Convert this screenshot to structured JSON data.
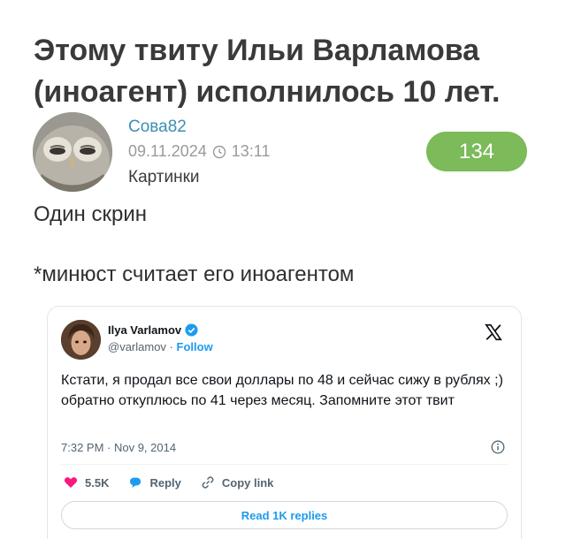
{
  "post": {
    "title": "Этому твиту Ильи Варламова (иноагент) исполнилось 10 лет.",
    "author": "Сова82",
    "date": "09.11.2024",
    "time": "13:11",
    "category": "Картинки",
    "rating": "134",
    "body_line_1": "Один скрин",
    "body_line_2": "*минюст считает его иноагентом"
  },
  "tweet": {
    "name": "Ilya Varlamov",
    "handle": "@varlamov",
    "separator": "·",
    "follow_label": "Follow",
    "text": "Кстати, я продал все свои доллары по 48 и сейчас сижу в рублях ;) обратно откуплюсь по 41 через месяц. Запомните этот твит",
    "timestamp": "7:32 PM · Nov 9, 2014",
    "likes": "5.5K",
    "reply_label": "Reply",
    "copy_link_label": "Copy link",
    "read_replies_label": "Read 1K replies"
  },
  "icons": {
    "owl_avatar": "owl-avatar",
    "clock": "clock-icon",
    "verified": "verified-badge-icon",
    "x_logo": "x-logo-icon",
    "info": "info-icon",
    "heart": "heart-icon",
    "reply": "reply-bubble-icon",
    "link": "link-icon"
  },
  "colors": {
    "author_link": "#3c8fb2",
    "rating_badge": "#7cba5a",
    "twitter_blue": "#1d9bf0",
    "heart_red": "#f91880"
  }
}
